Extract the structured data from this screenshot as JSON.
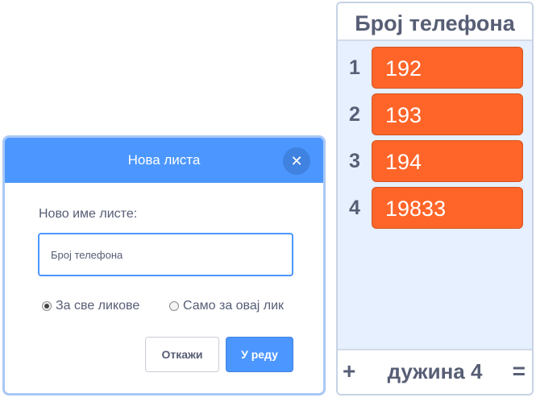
{
  "dialog": {
    "title": "Нова листа",
    "close_icon": "close-icon",
    "field_label": "Ново име листе:",
    "name_input_value": "Број телефона",
    "radio_options": [
      {
        "label": "За све ликове",
        "checked": true
      },
      {
        "label": "Само за овај лик",
        "checked": false
      }
    ],
    "cancel_label": "Откажи",
    "ok_label": "У реду"
  },
  "list_monitor": {
    "title": "Број телефона",
    "items": [
      {
        "index": "1",
        "value": "192"
      },
      {
        "index": "2",
        "value": "193"
      },
      {
        "index": "3",
        "value": "194"
      },
      {
        "index": "4",
        "value": "19833"
      }
    ],
    "add_label": "+",
    "length_label": "дужина 4",
    "resize_label": "="
  },
  "colors": {
    "accent_blue": "#4c97ff",
    "item_orange": "#ff6529",
    "monitor_bg": "#e6f0ff",
    "text_gray": "#575e75"
  }
}
